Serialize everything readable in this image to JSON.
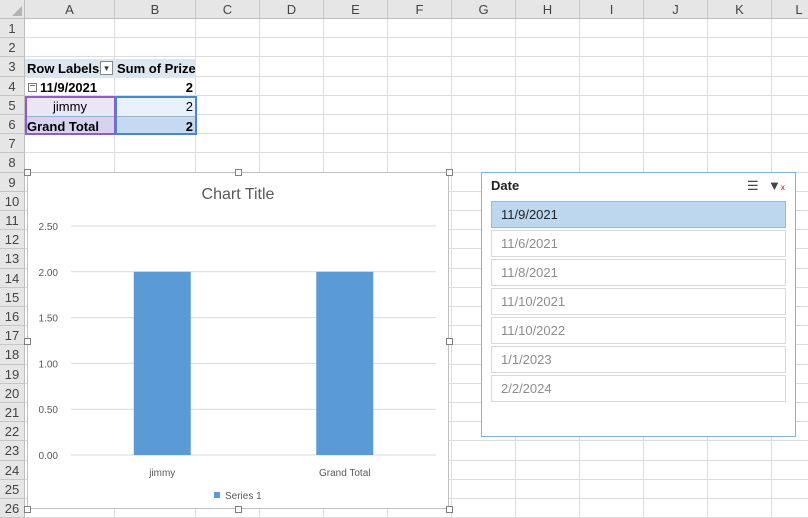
{
  "columns": [
    "A",
    "B",
    "C",
    "D",
    "E",
    "F",
    "G",
    "H",
    "I",
    "J",
    "K",
    "L"
  ],
  "rows": [
    "1",
    "2",
    "3",
    "4",
    "5",
    "6",
    "7",
    "8",
    "9",
    "10",
    "11",
    "12",
    "13",
    "14",
    "15",
    "16",
    "17",
    "18",
    "19",
    "20",
    "21",
    "22",
    "23",
    "24",
    "25",
    "26"
  ],
  "pivot": {
    "row_labels_header": "Row Labels",
    "value_header": "Sum of Prize",
    "group_label": "11/9/2021",
    "group_value": "2",
    "item_label": "jimmy",
    "item_value": "2",
    "total_label": "Grand Total",
    "total_value": "2"
  },
  "chart_data": {
    "type": "bar",
    "title": "Chart Title",
    "categories": [
      "jimmy",
      "Grand Total"
    ],
    "series": [
      {
        "name": "Series 1",
        "values": [
          2,
          2
        ]
      }
    ],
    "yticks": [
      "0.00",
      "0.50",
      "1.00",
      "1.50",
      "2.00",
      "2.50"
    ],
    "ylim": [
      0,
      2.5
    ],
    "grid": true,
    "legend": "bottom",
    "bar_color": "#5b9bd5"
  },
  "slicer": {
    "title": "Date",
    "items": [
      {
        "label": "11/9/2021",
        "selected": true
      },
      {
        "label": "11/6/2021",
        "selected": false
      },
      {
        "label": "11/8/2021",
        "selected": false
      },
      {
        "label": "11/10/2021",
        "selected": false
      },
      {
        "label": "11/10/2022",
        "selected": false
      },
      {
        "label": "1/1/2023",
        "selected": false
      },
      {
        "label": "2/2/2024",
        "selected": false
      }
    ]
  }
}
